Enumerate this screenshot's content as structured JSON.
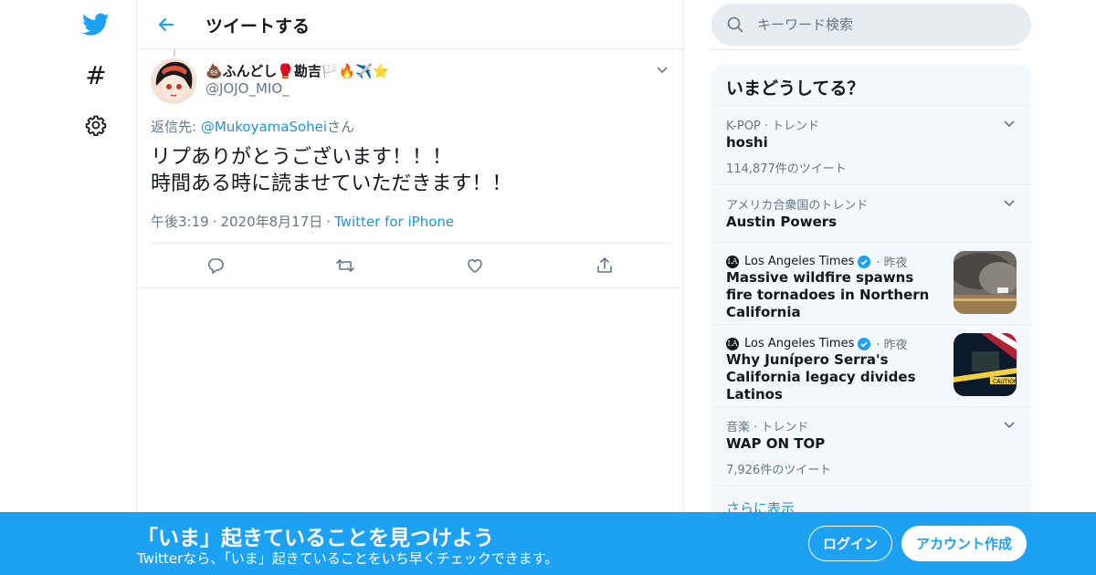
{
  "colors": {
    "accent": "#1da1f2",
    "link": "#1b95e0",
    "text": "#14171a",
    "muted": "#657786",
    "border": "#e6ecf0",
    "panel": "#f5f8fa"
  },
  "nav": {
    "icons": [
      "twitter-bird-icon",
      "hashtag-icon",
      "gear-icon"
    ]
  },
  "header": {
    "title": "ツイートする"
  },
  "tweet": {
    "display_name": "💩ふんどし🥊勘吉🏳️🔥✈️⭐",
    "handle": "@JOJO_MIO_",
    "reply_prefix": "返信先: ",
    "reply_user": "@MukoyamaSohei",
    "reply_suffix": "さん",
    "text_line1": "リプありがとうございます！！！",
    "text_line2": "時間ある時に読ませていただきます！！",
    "time": "午後3:19",
    "date": "2020年8月17日",
    "source": "Twitter for iPhone"
  },
  "search": {
    "placeholder": "キーワード検索"
  },
  "trends": {
    "title": "いまどうしてる？",
    "items": [
      {
        "context": "K-POP · トレンド",
        "name": "hoshi",
        "count": "114,877件のツイート"
      },
      {
        "context": "アメリカ合衆国のトレンド",
        "name": "Austin Powers"
      },
      {
        "source": "Los Angeles Times",
        "time": "昨夜",
        "headline": "Massive wildfire spawns fire tornadoes in Northern California"
      },
      {
        "source": "Los Angeles Times",
        "time": "昨夜",
        "headline": "Why Junípero Serra's California legacy divides Latinos"
      },
      {
        "context": "音楽 · トレンド",
        "name": "WAP ON TOP",
        "count": "7,926件のツイート"
      }
    ],
    "show_more": "さらに表示"
  },
  "banner": {
    "title": "「いま」起きていることを見つけよう",
    "subtitle": "Twitterなら、「いま」起きていることをいち早くチェックできます。",
    "login": "ログイン",
    "signup": "アカウント作成"
  }
}
